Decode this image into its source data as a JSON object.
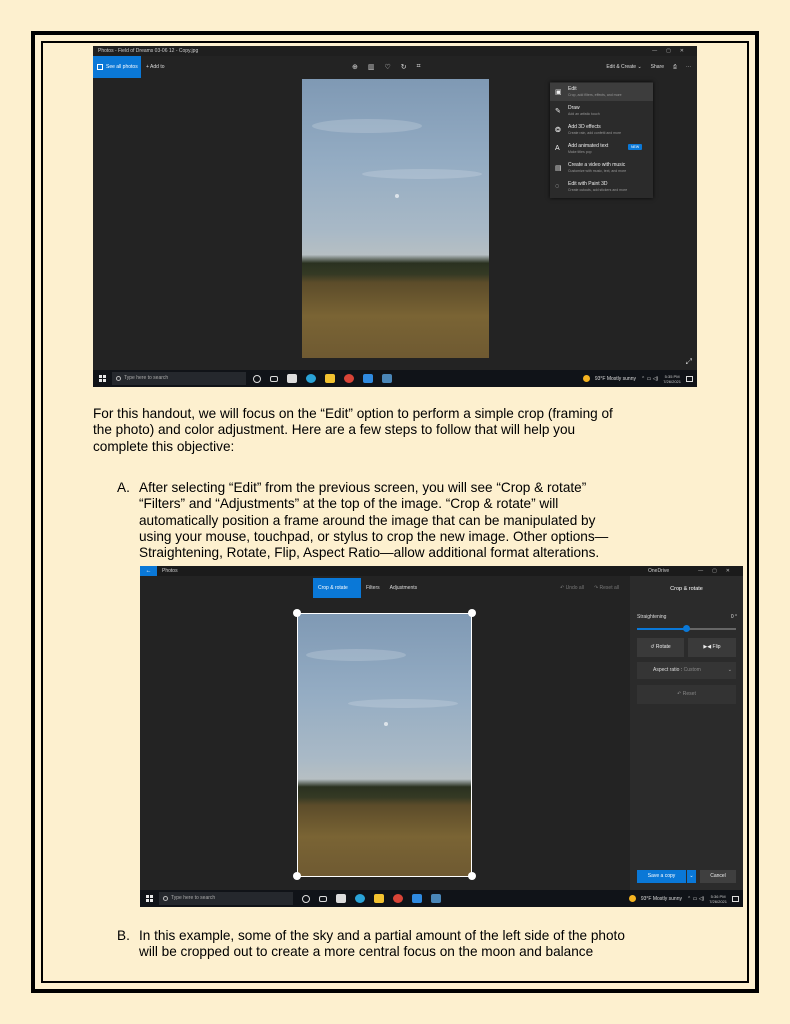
{
  "screenshot1": {
    "title": "Photos - Field of Dreams 03-06 12 - Copy.jpg",
    "window_controls": [
      "—",
      "▢",
      "✕"
    ],
    "see_all_photos": "See all photos",
    "add_to": "+  Add to",
    "center_icons": [
      "zoom-icon",
      "delete-icon",
      "favorite-icon",
      "rotate-icon",
      "crop-icon"
    ],
    "edit_create": "Edit & Create  ⌄",
    "share": "Share",
    "print_icon": "print-icon",
    "more": "···",
    "menu": [
      {
        "title": "Edit",
        "sub": "Crop, add filters, effects, and more",
        "icon": "edit-icon"
      },
      {
        "title": "Draw",
        "sub": "Add an artistic touch",
        "icon": "draw-icon"
      },
      {
        "title": "Add 3D effects",
        "sub": "Create rain, add confetti and more",
        "icon": "3d-effects-icon"
      },
      {
        "title": "Add animated text",
        "sub": "Make titles pop",
        "icon": "animated-text-icon",
        "badge": "NEW"
      },
      {
        "title": "Create a video with music",
        "sub": "Customize with music, text, and more",
        "icon": "video-icon"
      },
      {
        "title": "Edit with Paint 3D",
        "sub": "Create cutouts, add stickers and more",
        "icon": "paint3d-icon"
      }
    ],
    "taskbar": {
      "search_placeholder": "Type here to search",
      "weather": "93°F  Mostly sunny",
      "time": "5:35 PM",
      "date": "7/26/2021"
    }
  },
  "intro_lines": [
    "For this handout, we will focus on the “Edit” option to perform a simple crop (framing of",
    "the photo) and color adjustment. Here are a few steps to follow that will help you",
    "complete this objective:"
  ],
  "step_a": {
    "letter": "A.",
    "lines": [
      "After selecting “Edit” from the previous screen, you will see “Crop & rotate”",
      "“Filters” and “Adjustments” at the top of the image. “Crop & rotate” will",
      "automatically position a frame around the image that can be manipulated by",
      "using your mouse, touchpad, or stylus to crop the new image. Other options—",
      "Straightening, Rotate, Flip, Aspect Ratio—allow additional format alterations."
    ]
  },
  "screenshot2": {
    "app_name": "Photos",
    "onedrive": "OneDrive",
    "window_controls": [
      "—",
      "▢",
      "✕"
    ],
    "tabs": [
      "Crop & rotate",
      "Filters",
      "Adjustments"
    ],
    "undo": "↶  Undo all",
    "reset_all": "↷  Reset all",
    "panel_title": "Crop & rotate",
    "straightening_label": "Straightening",
    "straightening_value": "0 °",
    "straightening_fraction": 0.5,
    "rotate": "Rotate",
    "flip": "Flip",
    "aspect_label": "Aspect ratio :",
    "aspect_value": "Custom",
    "reset": "Reset",
    "save_copy": "Save a copy",
    "cancel": "Cancel",
    "taskbar": {
      "search_placeholder": "Type here to search",
      "weather": "93°F  Mostly sunny",
      "time": "5:36 PM",
      "date": "7/26/2021"
    }
  },
  "step_b": {
    "letter": "B.",
    "lines": [
      "In this example, some of the sky and a partial amount of the left side of the photo",
      "will be cropped out to create a more central focus on the moon and balance"
    ]
  },
  "colors": {
    "page_bg": "#fdf0cf",
    "accent": "#0a78d7",
    "app_bg": "#232323"
  }
}
